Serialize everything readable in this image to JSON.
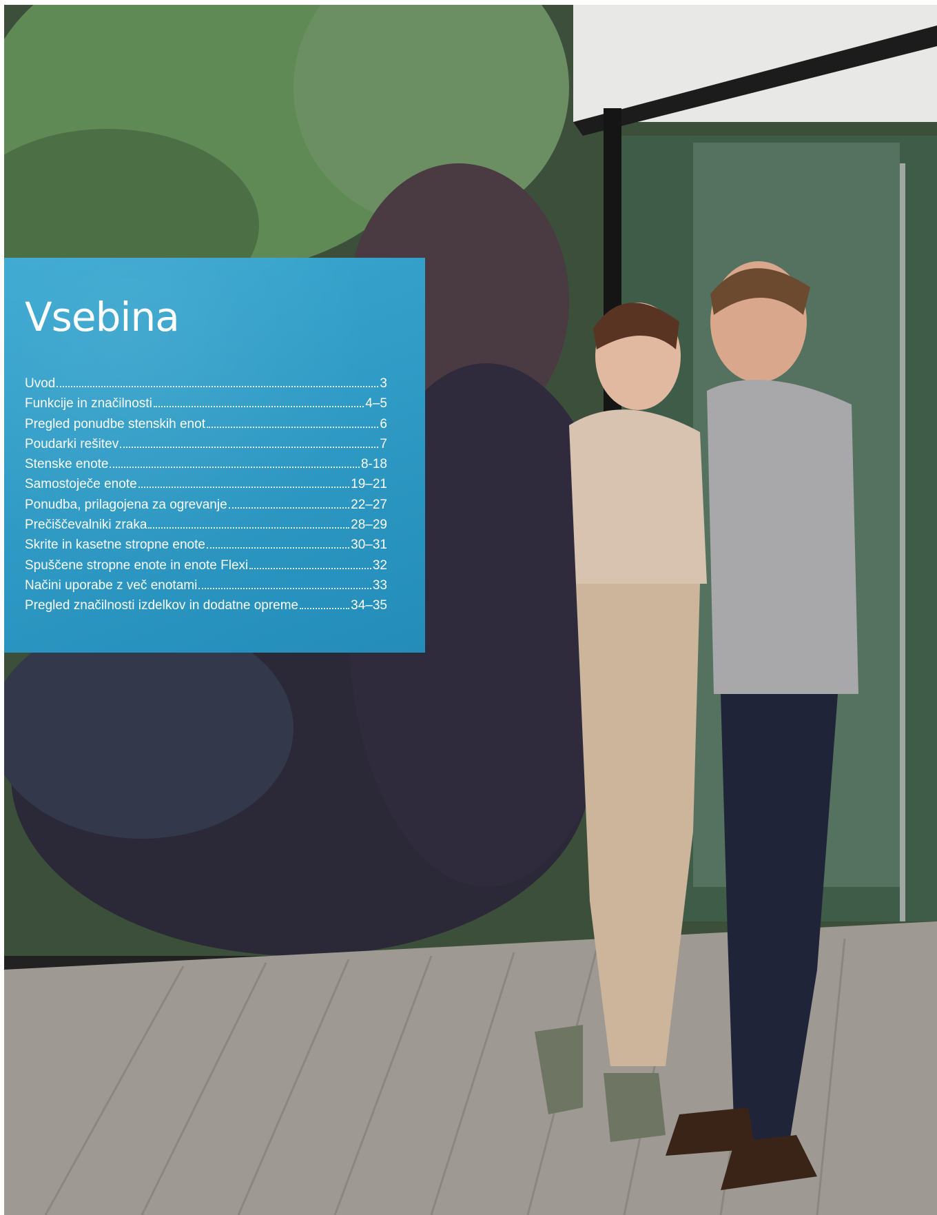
{
  "toc": {
    "title": "Vsebina",
    "items": [
      {
        "label": "Uvod",
        "page": "3"
      },
      {
        "label": "Funkcije in značilnosti",
        "page": "4–5"
      },
      {
        "label": "Pregled ponudbe stenskih enot",
        "page": "6"
      },
      {
        "label": "Poudarki rešitev",
        "page": "7"
      },
      {
        "label": "Stenske enote",
        "page": "8-18"
      },
      {
        "label": "Samostoječe enote",
        "page": "19–21"
      },
      {
        "label": "Ponudba, prilagojena za ogrevanje",
        "page": "22–27"
      },
      {
        "label": "Prečiščevalniki zraka",
        "page": "28–29"
      },
      {
        "label": "Skrite in kasetne stropne enote",
        "page": "30–31"
      },
      {
        "label": "Spuščene stropne enote in enote Flexi",
        "page": "32"
      },
      {
        "label": "Načini uporabe z več enotami",
        "page": "33"
      },
      {
        "label": "Pregled značilnosti izdelkov in dodatne opreme",
        "page": "34–35"
      }
    ]
  },
  "colors": {
    "panel": "#2a96c3",
    "text": "#ffffff"
  }
}
